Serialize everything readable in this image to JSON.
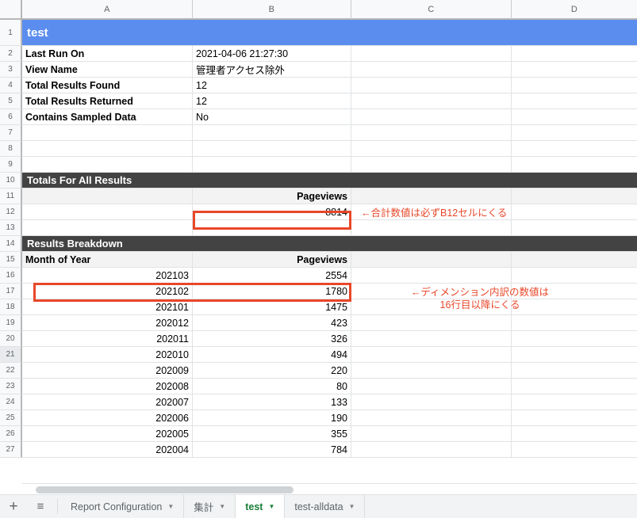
{
  "spreadsheet": {
    "columns": [
      "A",
      "B",
      "C",
      "D"
    ],
    "rows": [
      {
        "n": "1",
        "type": "banner",
        "style": "blue",
        "text": "test"
      },
      {
        "n": "2",
        "type": "data",
        "a": "Last Run On",
        "a_bold": true,
        "b": "2021-04-06 21:27:30"
      },
      {
        "n": "3",
        "type": "data",
        "a": "View Name",
        "a_bold": true,
        "b": "管理者アクセス除外"
      },
      {
        "n": "4",
        "type": "data",
        "a": "Total Results Found",
        "a_bold": true,
        "b": "12"
      },
      {
        "n": "5",
        "type": "data",
        "a": "Total Results Returned",
        "a_bold": true,
        "b": "12"
      },
      {
        "n": "6",
        "type": "data",
        "a": "Contains Sampled Data",
        "a_bold": true,
        "b": "No"
      },
      {
        "n": "7",
        "type": "data",
        "a": "",
        "b": ""
      },
      {
        "n": "8",
        "type": "data",
        "a": "",
        "b": ""
      },
      {
        "n": "9",
        "type": "data",
        "a": "",
        "b": ""
      },
      {
        "n": "10",
        "type": "banner",
        "style": "dark",
        "text": "Totals For All Results"
      },
      {
        "n": "11",
        "type": "data",
        "shaded": true,
        "a": "",
        "b": "Pageviews",
        "b_bold": true,
        "b_align": "right"
      },
      {
        "n": "12",
        "type": "data",
        "a": "",
        "b": "8814",
        "b_align": "right",
        "c": "←合計数値は必ずB12セルにくる"
      },
      {
        "n": "13",
        "type": "data",
        "a": "",
        "b": ""
      },
      {
        "n": "14",
        "type": "banner",
        "style": "dark",
        "text": "Results Breakdown"
      },
      {
        "n": "15",
        "type": "data",
        "shaded": true,
        "a": "Month of Year",
        "a_bold": true,
        "b": "Pageviews",
        "b_bold": true,
        "b_align": "right"
      },
      {
        "n": "16",
        "type": "data",
        "a": "202103",
        "a_align": "right",
        "b": "2554",
        "b_align": "right"
      },
      {
        "n": "17",
        "type": "data",
        "a": "202102",
        "a_align": "right",
        "b": "1780",
        "b_align": "right"
      },
      {
        "n": "18",
        "type": "data",
        "a": "202101",
        "a_align": "right",
        "b": "1475",
        "b_align": "right"
      },
      {
        "n": "19",
        "type": "data",
        "a": "202012",
        "a_align": "right",
        "b": "423",
        "b_align": "right"
      },
      {
        "n": "20",
        "type": "data",
        "a": "202011",
        "a_align": "right",
        "b": "326",
        "b_align": "right"
      },
      {
        "n": "21",
        "type": "data",
        "head_hl": true,
        "a": "202010",
        "a_align": "right",
        "b": "494",
        "b_align": "right"
      },
      {
        "n": "22",
        "type": "data",
        "a": "202009",
        "a_align": "right",
        "b": "220",
        "b_align": "right"
      },
      {
        "n": "23",
        "type": "data",
        "a": "202008",
        "a_align": "right",
        "b": "80",
        "b_align": "right"
      },
      {
        "n": "24",
        "type": "data",
        "a": "202007",
        "a_align": "right",
        "b": "133",
        "b_align": "right"
      },
      {
        "n": "25",
        "type": "data",
        "a": "202006",
        "a_align": "right",
        "b": "190",
        "b_align": "right"
      },
      {
        "n": "26",
        "type": "data",
        "a": "202005",
        "a_align": "right",
        "b": "355",
        "b_align": "right"
      },
      {
        "n": "27",
        "type": "data",
        "a": "202004",
        "a_align": "right",
        "b": "784",
        "b_align": "right"
      }
    ]
  },
  "annotations": [
    {
      "id": "annot-b12",
      "lines": [
        "←合計数値は必ずB12セルにくる"
      ],
      "color": "#e8472a"
    },
    {
      "id": "annot-a16",
      "lines": [
        "←ディメンション内訳の数値は",
        "16行目以降にくる"
      ],
      "color": "#e8472a"
    }
  ],
  "highlight_boxes": [
    {
      "id": "redbox-b12",
      "range": "B12",
      "color": "#e8472a"
    },
    {
      "id": "redbox-a16",
      "range": "A16:B16",
      "color": "#e8472a"
    }
  ],
  "sheet_bar": {
    "add_sheet_label": "+",
    "all_sheets_label": "≡",
    "tabs": [
      {
        "label": "Report Configuration",
        "active": false
      },
      {
        "label": "集計",
        "active": false
      },
      {
        "label": "test",
        "active": true
      },
      {
        "label": "test-alldata",
        "active": false
      }
    ],
    "caret": "▼",
    "active_color": "#188038",
    "inactive_color": "#5f6368"
  }
}
